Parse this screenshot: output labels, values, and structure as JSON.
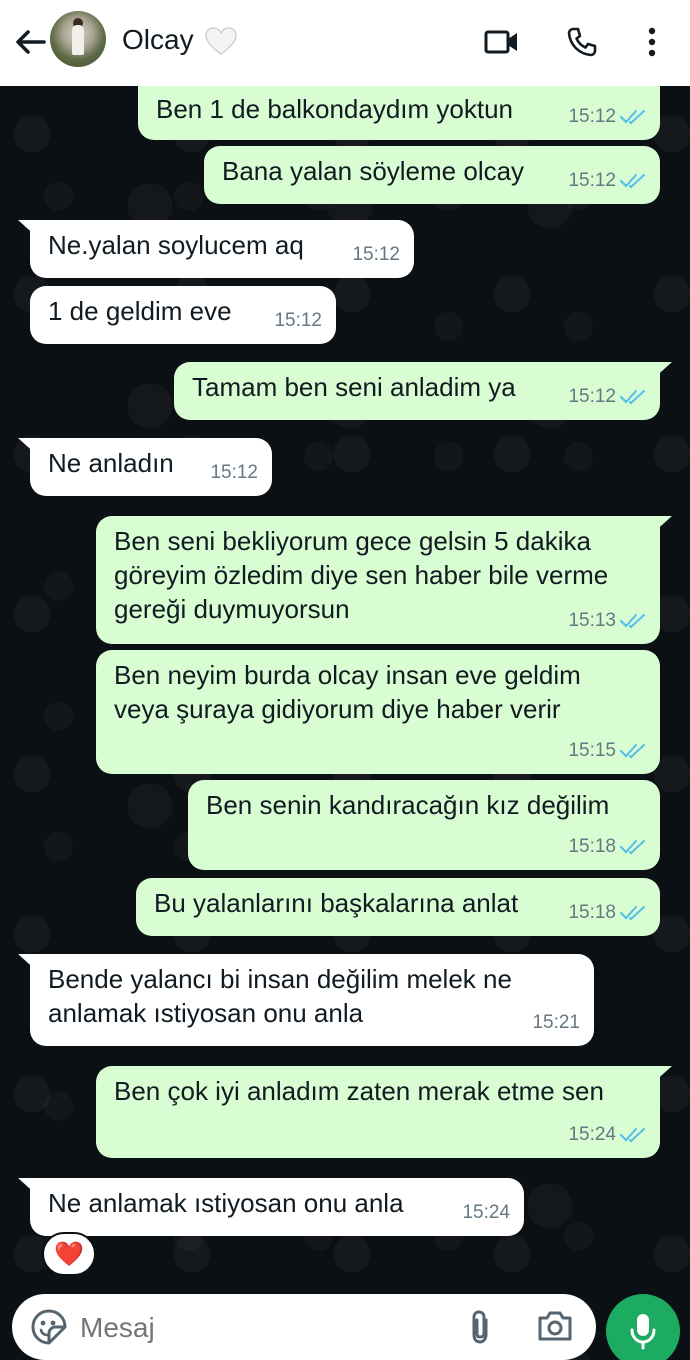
{
  "header": {
    "contact_name": "Olcay",
    "name_emoji": "🤍",
    "icons": [
      "back-arrow-icon",
      "video-call-icon",
      "phone-icon",
      "more-options-icon"
    ]
  },
  "messages": [
    {
      "direction": "out",
      "text": "Ben 1 de balkondaydım yoktun",
      "time": "15:12",
      "status": "read"
    },
    {
      "direction": "out",
      "text": "Bana yalan söyleme olcay",
      "time": "15:12",
      "status": "read"
    },
    {
      "direction": "in",
      "text": "Ne.yalan soylucem aq",
      "time": "15:12"
    },
    {
      "direction": "in",
      "text": "1 de geldim eve",
      "time": "15:12"
    },
    {
      "direction": "out",
      "text": "Tamam ben seni anladim ya",
      "time": "15:12",
      "status": "read"
    },
    {
      "direction": "in",
      "text": "Ne anladın",
      "time": "15:12"
    },
    {
      "direction": "out",
      "text": "Ben seni bekliyorum gece gelsin 5 dakika göreyim özledim diye sen haber bile verme gereği duymuyorsun",
      "time": "15:13",
      "status": "read"
    },
    {
      "direction": "out",
      "text": "Ben neyim burda olcay insan eve geldim veya şuraya gidiyorum diye haber verir",
      "time": "15:15",
      "status": "read"
    },
    {
      "direction": "out",
      "text": "Ben senin kandıracağın kız değilim",
      "time": "15:18",
      "status": "read"
    },
    {
      "direction": "out",
      "text": "Bu yalanlarını başkalarına anlat",
      "time": "15:18",
      "status": "read"
    },
    {
      "direction": "in",
      "text": "Bende yalancı bi insan değilim melek ne anlamak ıstiyosan onu anla",
      "time": "15:21"
    },
    {
      "direction": "out",
      "text": "Ben çok iyi anladım zaten merak etme sen",
      "time": "15:24",
      "status": "read"
    },
    {
      "direction": "in",
      "text": "Ne anlamak ıstiyosan onu anla",
      "time": "15:24",
      "reaction": "❤️"
    }
  ],
  "input": {
    "placeholder": "Mesaj"
  },
  "colors": {
    "outgoing_bubble": "#d9fdd3",
    "incoming_bubble": "#ffffff",
    "chat_background": "#0b1014",
    "read_check": "#53bdeb",
    "mic_button": "#1daa61",
    "timestamp": "#667781"
  }
}
